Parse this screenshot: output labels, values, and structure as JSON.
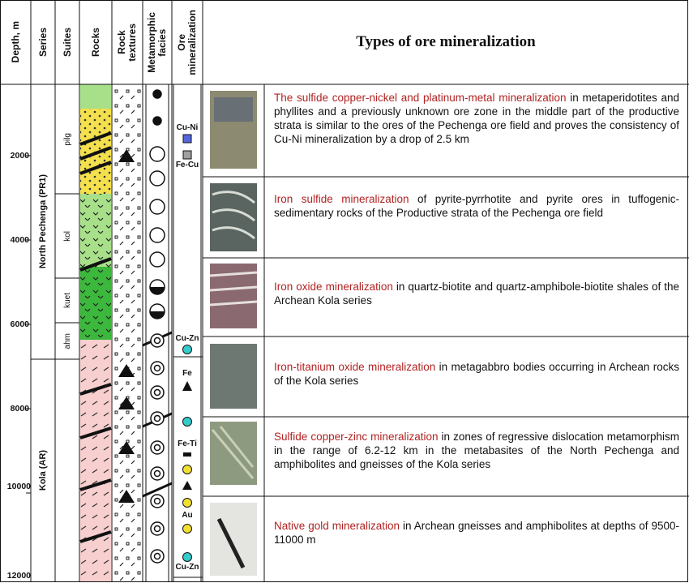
{
  "header": {
    "depth": "Depth, m",
    "series": "Series",
    "suites": "Suites",
    "rocks": "Rocks",
    "rock_textures": [
      "Rock",
      "textures"
    ],
    "metamorphic_facies": [
      "Metamorphic",
      "facies"
    ],
    "ore_mineralization": [
      "Ore",
      "mineralization"
    ],
    "title": "Types of ore mineralization"
  },
  "depth_ticks": [
    "2000",
    "4000",
    "6000",
    "8000",
    "10000",
    "12000"
  ],
  "series": [
    "North Pechenga (PR1)",
    "Kola (AR)"
  ],
  "suites": [
    "pilg",
    "kol",
    "kuet",
    "ahm"
  ],
  "ore_labels": [
    "Cu-Ni",
    "Fe-Cu",
    "Cu-Zn",
    "Fe",
    "Fe-Ti",
    "Au",
    "Cu-Zn"
  ],
  "colors": {
    "pilg": "#f4e04d",
    "kol": "#a8e08a",
    "kuet": "#3cb83c",
    "kola": "#f7cfcf",
    "cu_ni": "#5566dd",
    "fe_cu": "#a0a0a0",
    "cu_zn": "#33cccc",
    "au": "#f2e030",
    "highlight": "#b22222"
  },
  "rows": [
    {
      "highlight": "The sulfide copper-nickel and platinum-metal mineralization",
      "text": " in metaperidotites and phyllites and a previously unknown ore zone in the middle part of the productive strata is similar to the ores of the Pechenga ore field and proves the consistency of Cu-Ni mineralization by a drop of 2.5 km"
    },
    {
      "highlight": "Iron sulfide mineralization",
      "text": " of pyrite-pyrrhotite and pyrite ores in tuffogenic-sedimentary rocks of the Productive strata of the Pechenga ore field"
    },
    {
      "highlight": "Iron oxide mineralization",
      "text": " in quartz-biotite and quartz-amphibole-biotite shales of the Archean Kola series"
    },
    {
      "highlight": "Iron-titanium oxide mineralization",
      "text": " in metagabbro bodies occurring in Archean rocks of the Kola series"
    },
    {
      "highlight": "Sulfide copper-zinc mineralization",
      "text": " in zones of regressive dislocation metamorphism in the range of 6.2-12 km in the metabasites of the North Pechenga and amphibolites and gneisses of the Kola series"
    },
    {
      "highlight": "Native gold mineralization",
      "text": " in Archean gneisses and amphibolites at depths of 9500-11000 m"
    }
  ]
}
